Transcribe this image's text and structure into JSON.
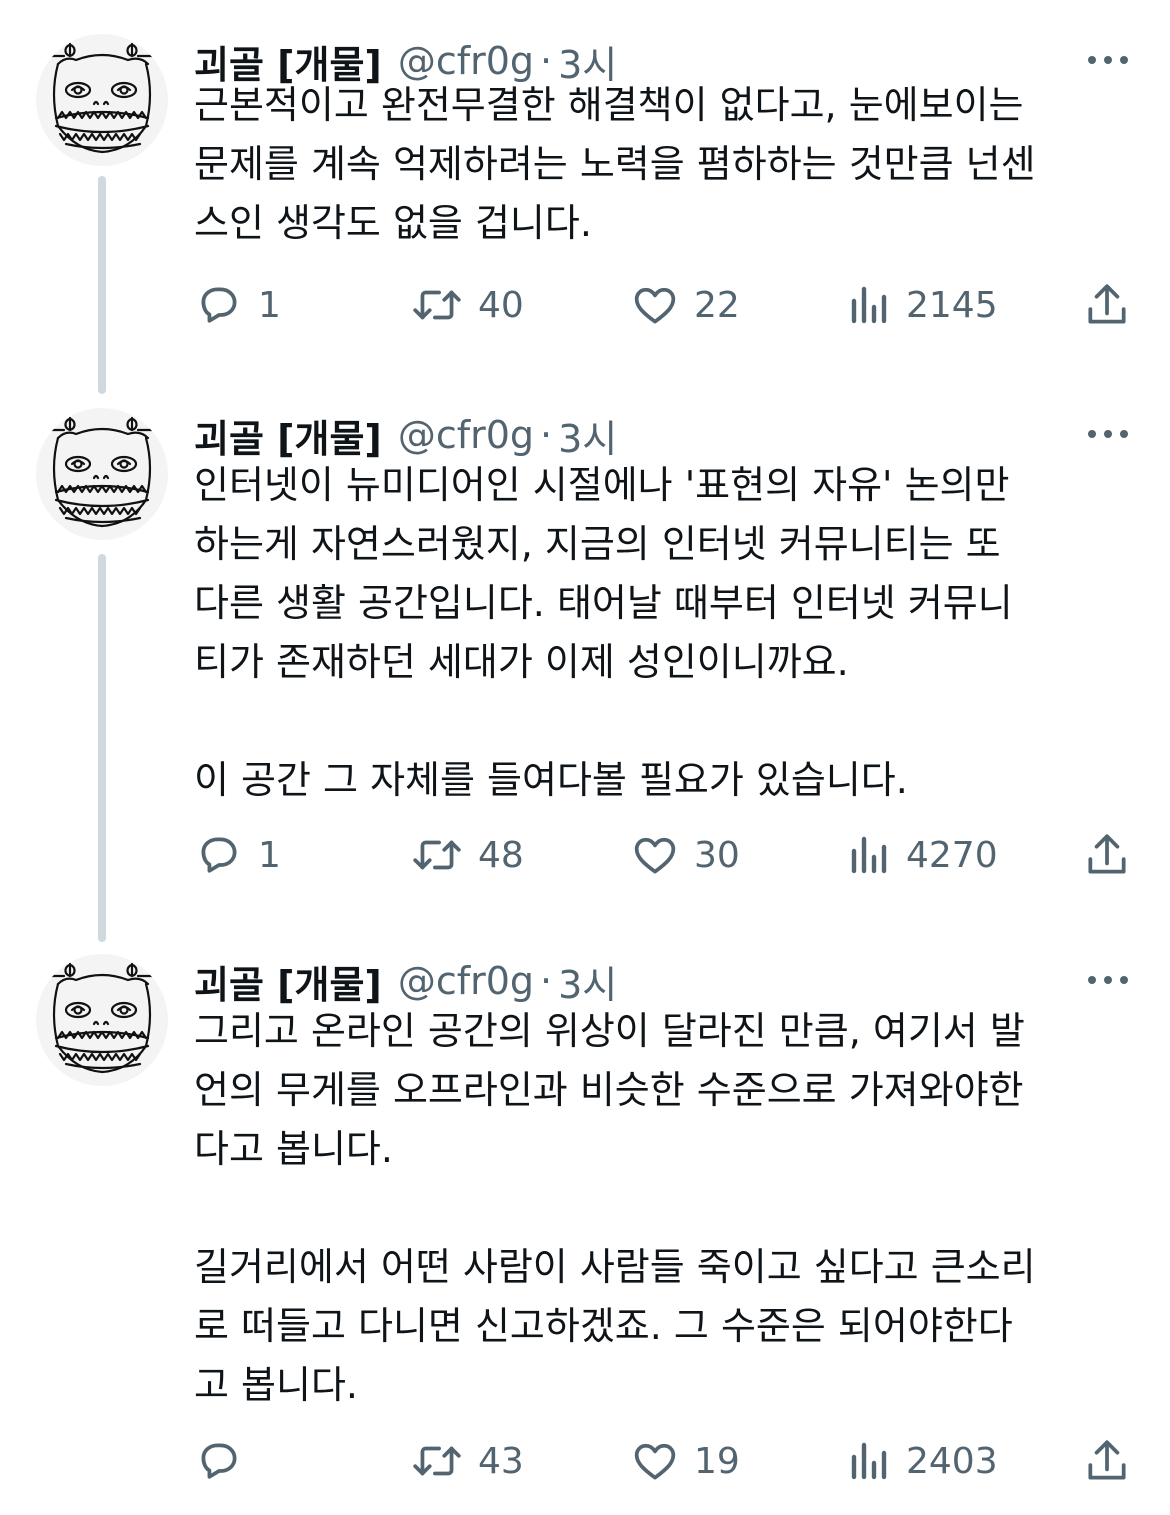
{
  "tweets": [
    {
      "display_name": "괴골 [개물]",
      "handle": "@cfr0g",
      "separator": "·",
      "time": "3시",
      "paragraphs": [
        "근본적이고 완전무결한 해결책이 없다고, 눈에보이는\n문제를 계속 억제하려는 노력을 폄하하는 것만큼 넌센\n스인 생각도 없을 겁니다."
      ],
      "replies": "1",
      "retweets": "40",
      "likes": "22",
      "views": "2145"
    },
    {
      "display_name": "괴골 [개물]",
      "handle": "@cfr0g",
      "separator": "·",
      "time": "3시",
      "paragraphs": [
        "인터넷이 뉴미디어인 시절에나 '표현의 자유' 논의만\n하는게 자연스러웠지, 지금의 인터넷 커뮤니티는 또\n다른 생활 공간입니다. 태어날 때부터 인터넷 커뮤니\n티가 존재하던 세대가 이제 성인이니까요.",
        "이 공간 그 자체를 들여다볼 필요가 있습니다."
      ],
      "replies": "1",
      "retweets": "48",
      "likes": "30",
      "views": "4270"
    },
    {
      "display_name": "괴골 [개물]",
      "handle": "@cfr0g",
      "separator": "·",
      "time": "3시",
      "paragraphs": [
        "그리고 온라인 공간의 위상이 달라진 만큼, 여기서 발\n언의 무게를 오프라인과 비슷한 수준으로 가져와야한\n다고 봅니다.",
        "길거리에서 어떤 사람이 사람들 죽이고 싶다고 큰소리\n로 떠들고 다니면 신고하겠죠. 그 수준은 되어야한다\n고 봅니다."
      ],
      "replies": "",
      "retweets": "43",
      "likes": "19",
      "views": "2403"
    }
  ],
  "icons": {
    "avatar": "doodle-face-avatar",
    "more": "more-horizontal-icon",
    "reply": "reply-bubble-icon",
    "retweet": "retweet-arrows-icon",
    "like": "heart-icon",
    "views": "bar-chart-icon",
    "share": "share-upload-icon"
  },
  "colors": {
    "text": "#0f1419",
    "secondary": "#536471",
    "thread_line": "#cfd9de",
    "background": "#ffffff"
  }
}
